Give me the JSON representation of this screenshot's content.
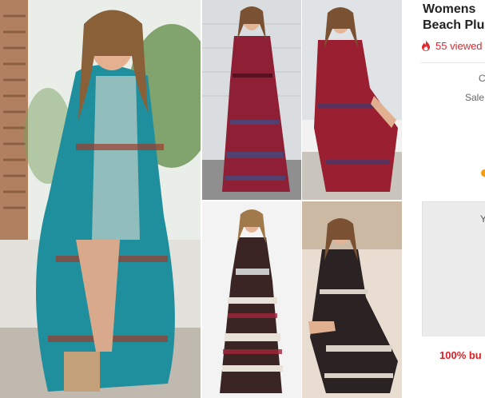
{
  "product": {
    "title_line1": "Womens",
    "title_line2": "Beach Plu",
    "viewed_text": "55 viewed",
    "meta_1": "C",
    "meta_2": "Sale"
  },
  "promo": {
    "text": "Y",
    "guarantee": "100% bu"
  },
  "gallery": {
    "photos": [
      {
        "name": "Teal boho maxi dress seated model"
      },
      {
        "name": "Burgundy boho maxi dress standing"
      },
      {
        "name": "Burgundy boho maxi dress seated"
      },
      {
        "name": "Black boho maxi dress with belt"
      },
      {
        "name": "Black boho maxi dress on sand"
      }
    ]
  },
  "colors": {
    "accent_red": "#e0262e",
    "guarantee_red": "#d71f26",
    "orange_dot": "#f39c12",
    "title_text": "#222222"
  },
  "icons": {
    "viewed": "fire-icon"
  }
}
